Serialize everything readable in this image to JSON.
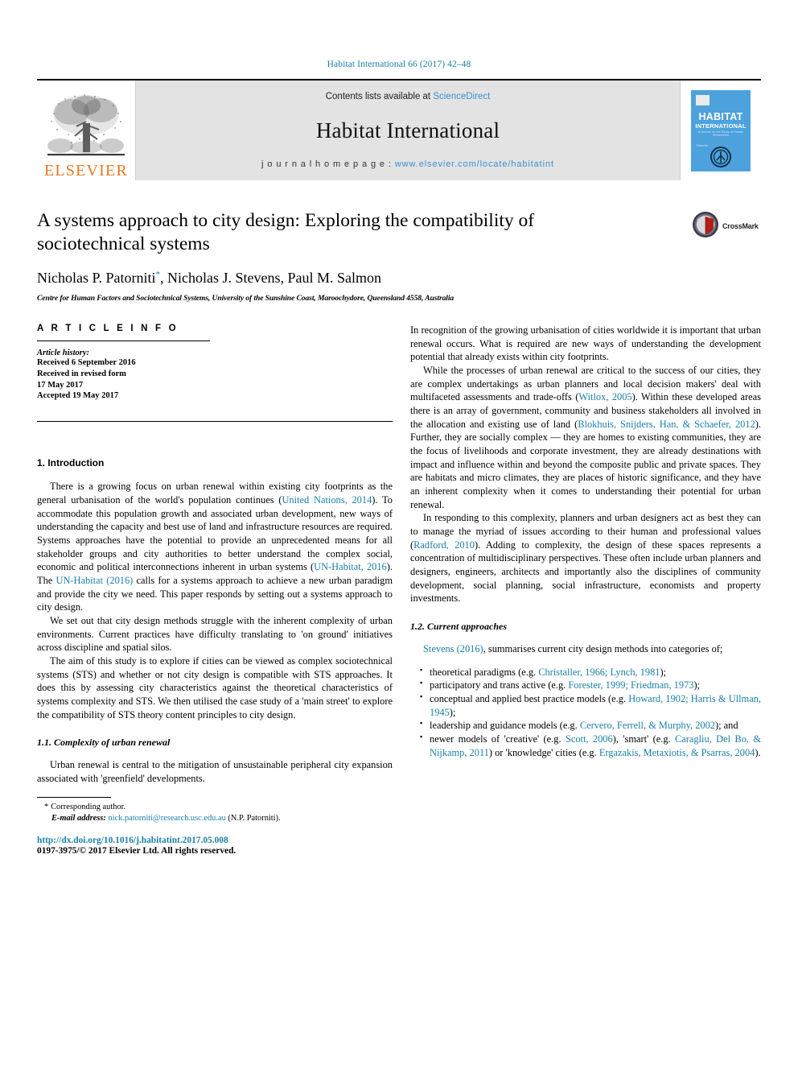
{
  "running_head": "Habitat International 66 (2017) 42–48",
  "banner": {
    "publisher_name": "ELSEVIER",
    "publisher_logo_icon": "elsevier-tree-logo",
    "contents_prefix": "Contents lists available at ",
    "contents_link": "ScienceDirect",
    "journal_name": "Habitat International",
    "homepage_prefix": "j o u r n a l   h o m e p a g e :  ",
    "homepage_url": "www.elsevier.com/locate/habitatint",
    "cover": {
      "title_line1": "HABITAT",
      "title_line2": "INTERNATIONAL",
      "subtitle": "A Journal for the Study of Human Settlements",
      "note": "Elsevier",
      "emblem_icon": "un-habitat-emblem",
      "barcode_icon": "barcode-icon",
      "background_color": "#4da2dd"
    }
  },
  "article": {
    "title": "A systems approach to city design: Exploring the compatibility of sociotechnical systems",
    "authors_pre": "Nicholas P. Patorniti",
    "authors_star": "*",
    "authors_post": ", Nicholas J. Stevens, Paul M. Salmon",
    "affiliation": "Centre for Human Factors and Sociotechnical Systems, University of the Sunshine Coast, Maroochydore, Queensland 4558, Australia",
    "crossmark_label": "CrossMark",
    "crossmark_icon": "crossmark-logo"
  },
  "article_info": {
    "heading": "A R T I C L E   I N F O",
    "history_label": "Article history:",
    "history_lines": [
      "Received 6 September 2016",
      "Received in revised form",
      "17 May 2017",
      "Accepted 19 May 2017"
    ]
  },
  "left_column": {
    "section_heading": "1.  Introduction",
    "para1_a": "There is a growing focus on urban renewal within existing city footprints as the general urbanisation of the world's population continues (",
    "para1_cite1": "United Nations, 2014",
    "para1_b": "). To accommodate this population growth and associated urban development, new ways of understanding the capacity and best use of land and infrastructure resources are required. Systems approaches have the potential to provide an unprecedented means for all stakeholder groups and city authorities to better understand the complex social, economic and political interconnections inherent in urban systems (",
    "para1_cite2": "UN-Habitat, 2016",
    "para1_c": "). The ",
    "para1_cite3": "UN-Habitat (2016)",
    "para1_d": " calls for a systems approach to achieve a new urban paradigm and provide the city we need. This paper responds by setting out a systems approach to city design.",
    "para2": "We set out that city design methods struggle with the inherent complexity of urban environments. Current practices have difficulty translating to 'on ground' initiatives across discipline and spatial silos.",
    "para3": "The aim of this study is to explore if cities can be viewed as complex sociotechnical systems (STS) and whether or not city design is compatible with STS approaches. It does this by assessing city characteristics against the theoretical characteristics of systems complexity and STS. We then utilised the case study of a 'main street' to explore the compatibility of STS theory content principles to city design.",
    "subsection_heading": "1.1.  Complexity of urban renewal",
    "para4": "Urban renewal is central to the mitigation of unsustainable peripheral city expansion associated with 'greenfield' developments."
  },
  "footnote": {
    "corresponding_star": "*",
    "corresponding_text": "Corresponding author.",
    "email_label": "E-mail address:",
    "email_link": "nick.patorniti@research.usc.edu.au",
    "email_suffix": " (N.P. Patorniti).",
    "doi": "http://dx.doi.org/10.1016/j.habitatint.2017.05.008",
    "copyright": "0197-3975/© 2017 Elsevier Ltd. All rights reserved."
  },
  "right_column": {
    "para1": "In recognition of the growing urbanisation of cities worldwide it is important that urban renewal occurs. What is required are new ways of understanding the development potential that already exists within city footprints.",
    "para2_a": "While the processes of urban renewal are critical to the success of our cities, they are complex undertakings as urban planners and local decision makers' deal with multifaceted assessments and trade-offs (",
    "para2_cite1": "Witlox, 2005",
    "para2_b": "). Within these developed areas there is an array of government, community and business stakeholders all involved in the allocation and existing use of land (",
    "para2_cite2": "Blokhuis, Snijders, Han, & Schaefer, 2012",
    "para2_c": "). Further, they are socially complex — they are homes to existing communities, they are the focus of livelihoods and corporate investment, they are already destinations with impact and influence within and beyond the composite public and private spaces. They are habitats and micro climates, they are places of historic significance, and they have an inherent complexity when it comes to understanding their potential for urban renewal.",
    "para3_a": "In responding to this complexity, planners and urban designers act as best they can to manage the myriad of issues according to their human and professional values (",
    "para3_cite1": "Radford, 2010",
    "para3_b": "). Adding to complexity, the design of these spaces represents a concentration of multidisciplinary perspectives. These often include urban planners and designers, engineers, architects and importantly also the disciplines of community development, social planning, social infrastructure, economists and property investments.",
    "subsection_heading": "1.2.  Current approaches",
    "para4_cite": "Stevens (2016)",
    "para4_text": ", summarises current city design methods into categories of;",
    "bullets": [
      {
        "pre": "theoretical paradigms (e.g. ",
        "cite": "Christaller, 1966; Lynch, 1981",
        "post": ");"
      },
      {
        "pre": "participatory and trans active (e.g. ",
        "cite": "Forester, 1999; Friedman, 1973",
        "post": ");"
      },
      {
        "pre": "conceptual and applied best practice models (e.g. ",
        "cite": "Howard, 1902; Harris & Ullman, 1945",
        "post": ");"
      },
      {
        "pre": "leadership and guidance models (e.g. ",
        "cite": "Cervero, Ferrell, & Murphy, 2002",
        "post": "); and"
      },
      {
        "pre": "newer models of 'creative' (e.g. ",
        "cite": "Scott, 2006",
        "post": "), 'smart' (e.g. ",
        "cite2": "Caragliu, Del Bo, & Nijkamp, 2011",
        "post2": ") or 'knowledge' cities (e.g. ",
        "cite3": "Ergazakis, Metaxiotis, & Psarras, 2004",
        "post3": ")."
      }
    ]
  },
  "colors": {
    "citation_link": "#1a7fa8",
    "science_direct_link": "#3a8fd0",
    "elsevier_orange": "#e87722",
    "cover_blue": "#4da2dd"
  }
}
